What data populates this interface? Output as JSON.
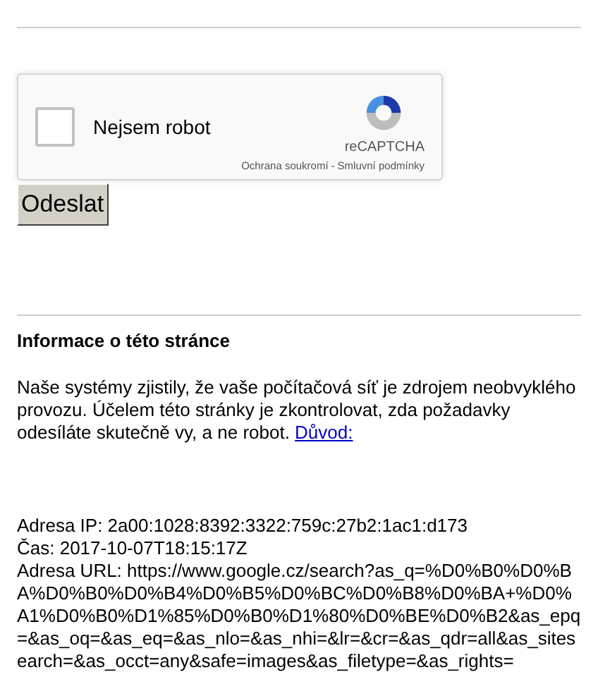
{
  "captcha": {
    "checked": false,
    "label": "Nejsem robot",
    "brand": "reCAPTCHA",
    "privacy_link": "Ochrana soukromí",
    "separator": "-",
    "terms_link": "Smluvní podmínky"
  },
  "submit_button": "Odeslat",
  "info": {
    "heading": "Informace o této stránce",
    "paragraph": "Naše systémy zjistily, že vaše počítačová síť je zdrojem neobvyklého provozu. Účelem této stránky je zkontrolovat, zda požadavky odesíláte skutečně vy, a ne robot.",
    "link": "Důvod:",
    "details": [
      "Adresa IP: 2a00:1028:8392:3322:759c:27b2:1ac1:d173",
      "Čas: 2017-10-07T18:15:17Z"
    ],
    "url_label": "Adresa URL:",
    "url": "https://www.google.cz/search?as_q=%D0%B0%D0%BA%D0%B0%D0%B4%D0%B5%D0%BC%D0%B8%D0%BA+%D0%A1%D0%B0%D1%85%D0%B0%D1%80%D0%BE%D0%B2&as_epq=&as_oq=&as_eq=&as_nlo=&as_nhi=&lr=&cr=&as_qdr=all&as_sitesearch=&as_occt=any&safe=images&as_filetype=&as_rights="
  }
}
